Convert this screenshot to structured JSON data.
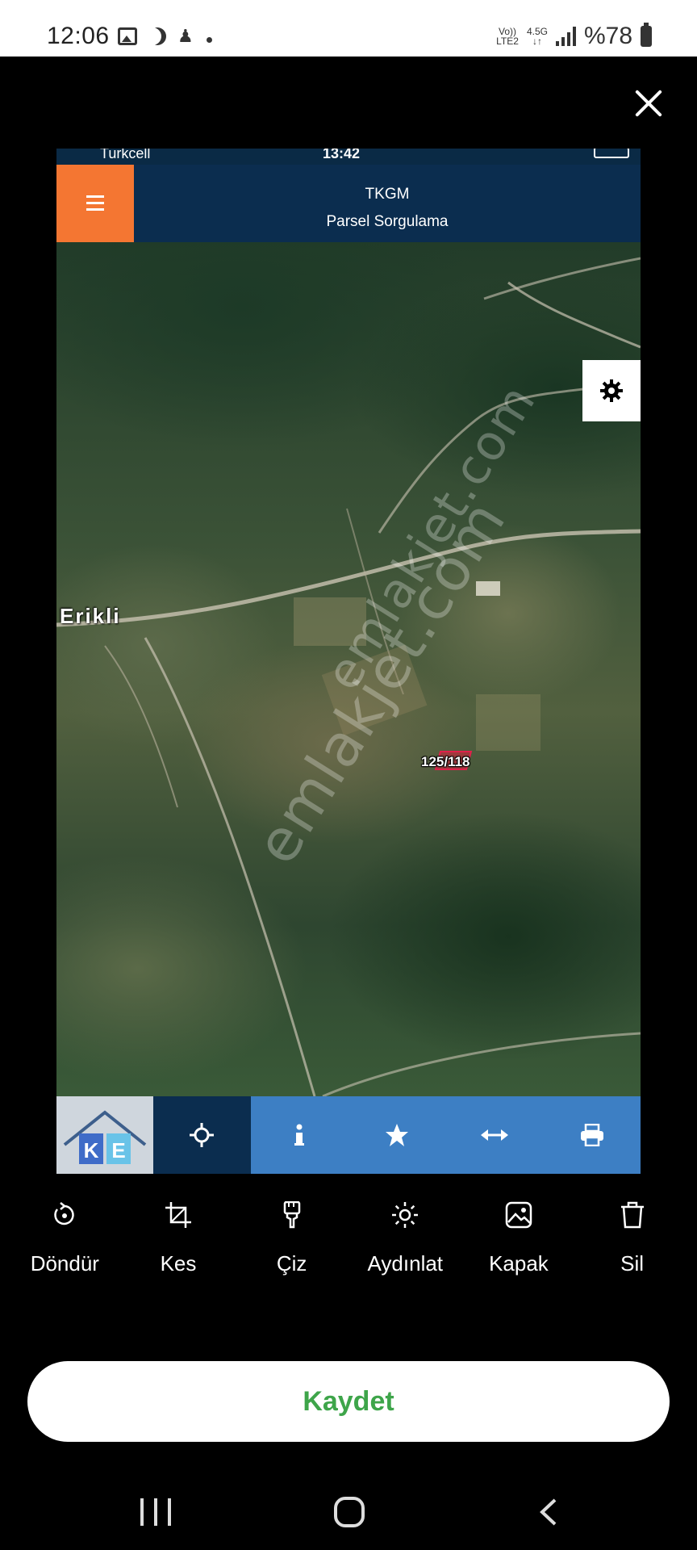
{
  "status_bar": {
    "time": "12:06",
    "network_top": "Vo))",
    "network_bottom": "LTE2",
    "data_type": "4.5G",
    "battery": "%78"
  },
  "screenshot": {
    "inner_status": {
      "carrier": "Turkcell",
      "clock": "13:42"
    },
    "header": {
      "title": "TKGM",
      "subtitle": "Parsel Sorgulama"
    },
    "map": {
      "town_label": "Erikli",
      "parcel_label": "125/118",
      "watermark": "emlakjet.com"
    },
    "toolbar": {
      "logo_letters": [
        "K",
        "E"
      ],
      "icons": [
        "crosshair-icon",
        "info-icon",
        "star-icon",
        "arrows-horizontal-icon",
        "print-icon"
      ]
    }
  },
  "editor_tools": [
    {
      "label": "Döndür",
      "icon": "rotate-icon"
    },
    {
      "label": "Kes",
      "icon": "crop-icon"
    },
    {
      "label": "Çiz",
      "icon": "brush-icon"
    },
    {
      "label": "Aydınlat",
      "icon": "brightness-icon"
    },
    {
      "label": "Kapak",
      "icon": "cover-image-icon"
    },
    {
      "label": "Sil",
      "icon": "trash-icon"
    }
  ],
  "save_button": "Kaydet",
  "colors": {
    "save_text": "#3ea54a",
    "header_bg": "#0b2d4f",
    "menu_bg": "#f47632",
    "toolbar_bg": "#3d7fc4"
  }
}
